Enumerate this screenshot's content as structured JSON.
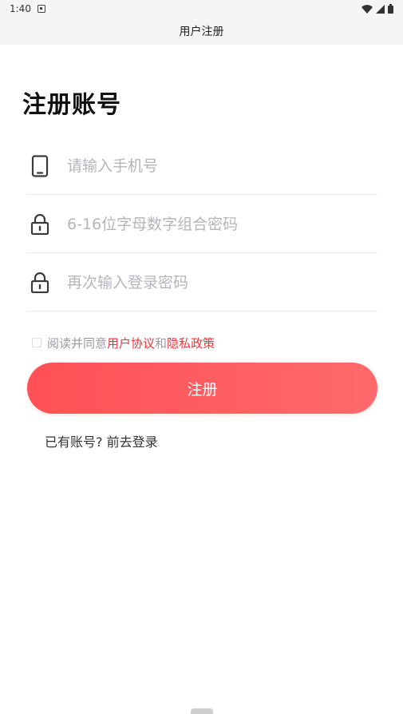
{
  "status_bar": {
    "time": "1:40"
  },
  "nav": {
    "title": "用户注册"
  },
  "page": {
    "title": "注册账号"
  },
  "form": {
    "phone_placeholder": "请输入手机号",
    "password_placeholder": "6-16位字母数字组合密码",
    "confirm_placeholder": "再次输入登录密码"
  },
  "agreement": {
    "prefix": "阅读并同意",
    "user_agreement": "用户协议",
    "conjunction": "和",
    "privacy_policy": "隐私政策"
  },
  "register_button": {
    "label": "注册"
  },
  "login_link": {
    "label": "已有账号? 前去登录"
  },
  "colors": {
    "accent": "#ff5055",
    "link": "#f0353b",
    "placeholder": "#b5b5bb"
  }
}
